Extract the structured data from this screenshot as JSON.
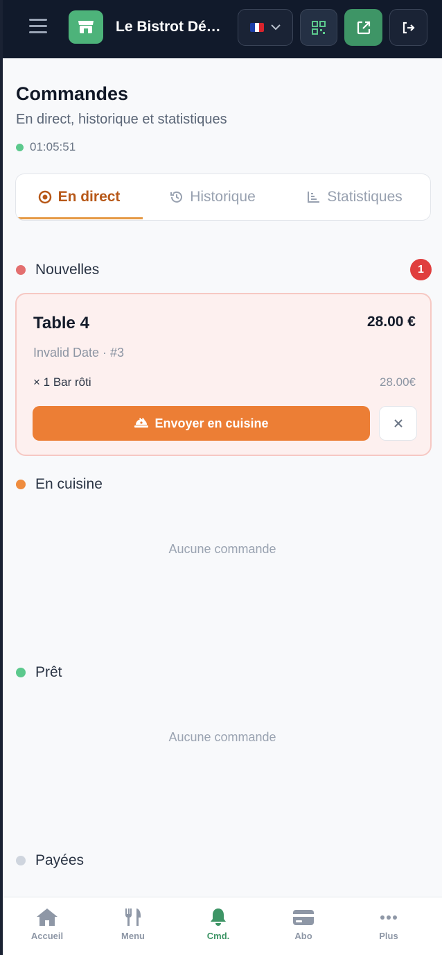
{
  "header": {
    "restaurant_name": "Le Bistrot Dé…",
    "flag_colors": [
      "#1d3fa8",
      "#ffffff",
      "#d8232c"
    ]
  },
  "page": {
    "title": "Commandes",
    "subtitle": "En direct, historique et statistiques",
    "clock": "01:05:51"
  },
  "tabs": [
    {
      "label": "En direct",
      "icon": "record-circle-icon",
      "active": true
    },
    {
      "label": "Historique",
      "icon": "history-icon",
      "active": false
    },
    {
      "label": "Statistiques",
      "icon": "bar-chart-icon",
      "active": false
    }
  ],
  "sections": {
    "new": {
      "label": "Nouvelles",
      "count": "1",
      "color": "#e36f6f"
    },
    "kitchen": {
      "label": "En cuisine",
      "empty": "Aucune commande",
      "color": "#ef8c3e"
    },
    "ready": {
      "label": "Prêt",
      "empty": "Aucune commande",
      "color": "#5cc98d"
    },
    "paid": {
      "label": "Payées",
      "color": "#cfd5de"
    }
  },
  "order": {
    "table": "Table 4",
    "total": "28.00 €",
    "meta": "Invalid Date · #3",
    "item": "× 1 Bar rôti",
    "item_price": "28.00€",
    "send_label": "Envoyer en cuisine"
  },
  "nav": [
    {
      "label": "Accueil",
      "icon": "home-icon"
    },
    {
      "label": "Menu",
      "icon": "utensils-icon"
    },
    {
      "label": "Cmd.",
      "icon": "bell-icon",
      "active": true
    },
    {
      "label": "Abo",
      "icon": "credit-card-icon"
    },
    {
      "label": "Plus",
      "icon": "more-horizontal-icon"
    }
  ],
  "colors": {
    "accent_green": "#3e9566",
    "accent_orange": "#ec7e35",
    "header_bg": "#111a2b",
    "badge_red": "#e03e3e"
  }
}
